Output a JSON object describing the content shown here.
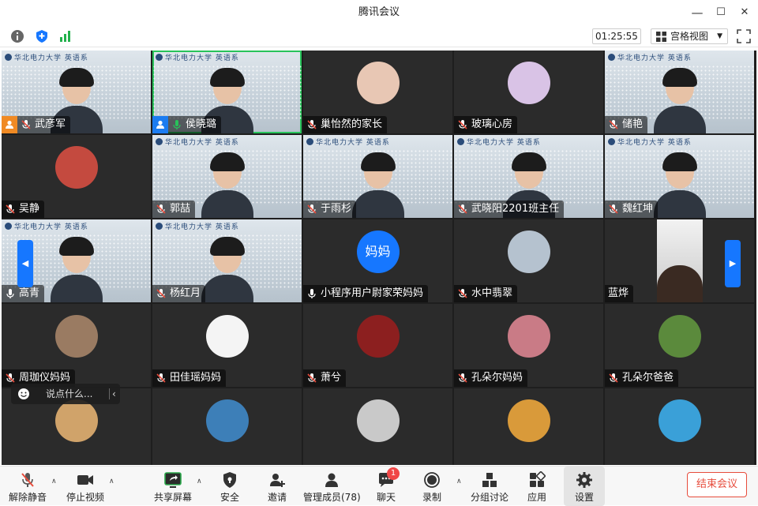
{
  "window": {
    "title": "腾讯会议",
    "minimize": "—",
    "maximize": "☐",
    "close": "✕"
  },
  "infobar": {
    "timer": "01:25:55",
    "view_label": "宫格视图"
  },
  "video_brand": "华北电力大学 英语系",
  "tiles": [
    {
      "name": "武彦军",
      "type": "video",
      "host": true
    },
    {
      "name": "侯晓璐",
      "type": "video",
      "cohost": true,
      "active": true
    },
    {
      "name": "巢怡然的家长",
      "type": "avatar",
      "color": "#e8c7b4"
    },
    {
      "name": "玻璃心房",
      "type": "avatar",
      "color": "#d9c3e6"
    },
    {
      "name": "储艳",
      "type": "video"
    },
    {
      "name": "吴静",
      "type": "avatar",
      "color": "#c44a3f"
    },
    {
      "name": "郭喆",
      "type": "video"
    },
    {
      "name": "于雨杉",
      "type": "video"
    },
    {
      "name": "武晓阳2201班主任",
      "type": "video"
    },
    {
      "name": "魏红坤",
      "type": "video"
    },
    {
      "name": "高青",
      "type": "video"
    },
    {
      "name": "杨红月",
      "type": "video"
    },
    {
      "name": "小程序用户尉家荣妈妈",
      "type": "text-avatar",
      "avatar_text": "妈妈",
      "color": "#1677ff"
    },
    {
      "name": "水中翡翠",
      "type": "avatar",
      "color": "#b5c2cf"
    },
    {
      "name": "蓝烨",
      "type": "camera"
    },
    {
      "name": "周珈仪妈妈",
      "type": "avatar",
      "color": "#9a7b62"
    },
    {
      "name": "田佳瑶妈妈",
      "type": "avatar",
      "color": "#f4f4f4"
    },
    {
      "name": "萧兮",
      "type": "avatar",
      "color": "#8c1f1f"
    },
    {
      "name": "孔朵尔妈妈",
      "type": "avatar",
      "color": "#c97b86"
    },
    {
      "name": "孔朵尔爸爸",
      "type": "avatar",
      "color": "#5b8a3c"
    },
    {
      "name": "",
      "type": "avatar",
      "color": "#d0a36a"
    },
    {
      "name": "",
      "type": "avatar",
      "color": "#3d7fb8"
    },
    {
      "name": "",
      "type": "avatar",
      "color": "#c9c9c9"
    },
    {
      "name": "",
      "type": "avatar",
      "color": "#d99a3a"
    },
    {
      "name": "",
      "type": "avatar",
      "color": "#3aa0d8"
    }
  ],
  "chat": {
    "placeholder": "说点什么..."
  },
  "toolbar": {
    "unmute": "解除静音",
    "stop_video": "停止视频",
    "share_screen": "共享屏幕",
    "security": "安全",
    "invite": "邀请",
    "members": "管理成员(78)",
    "chat": "聊天",
    "chat_badge": "1",
    "record": "录制",
    "breakout": "分组讨论",
    "apps": "应用",
    "settings": "设置",
    "end": "结束会议"
  },
  "colors": {
    "accent": "#1677ff",
    "end": "#e74c3c",
    "active_border": "#28c35a",
    "host_badge": "#f08a24"
  }
}
